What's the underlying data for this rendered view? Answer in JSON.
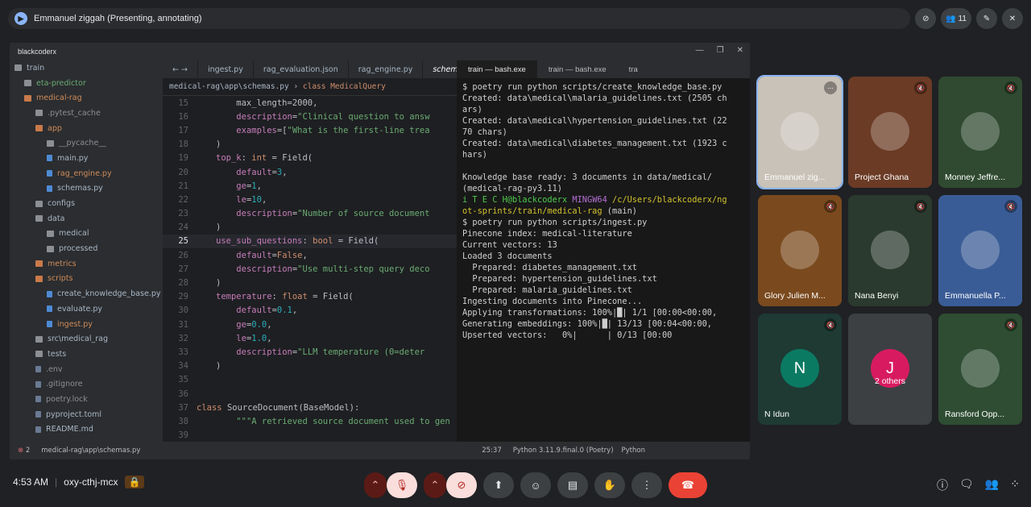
{
  "meeting": {
    "presenter": "Emmanuel ziggah (Presenting, annotating)",
    "time": "4:53 AM",
    "code": "oxy-cthj-mcx",
    "participant_count": "11"
  },
  "ide": {
    "window_title": "blackcoderx",
    "tree": [
      {
        "label": "train",
        "indent": 6,
        "type": "folder",
        "color": "#a9b7c6"
      },
      {
        "label": "eta-predictor",
        "indent": 18,
        "type": "folder",
        "color": "#6aab73"
      },
      {
        "label": "medical-rag",
        "indent": 18,
        "type": "folder-or",
        "color": "#d08c5a"
      },
      {
        "label": ".pytest_cache",
        "indent": 32,
        "type": "folder",
        "color": "#8c8f94"
      },
      {
        "label": "app",
        "indent": 32,
        "type": "folder-or",
        "color": "#d08c5a"
      },
      {
        "label": "__pycache__",
        "indent": 46,
        "type": "folder",
        "color": "#8c8f94"
      },
      {
        "label": "main.py",
        "indent": 46,
        "type": "file-py",
        "color": "#a9b7c6"
      },
      {
        "label": "rag_engine.py",
        "indent": 46,
        "type": "file-py",
        "color": "#d08c5a"
      },
      {
        "label": "schemas.py",
        "indent": 46,
        "type": "file-py",
        "color": "#a9b7c6"
      },
      {
        "label": "configs",
        "indent": 32,
        "type": "folder",
        "color": "#a9b7c6"
      },
      {
        "label": "data",
        "indent": 32,
        "type": "folder",
        "color": "#a9b7c6"
      },
      {
        "label": "medical",
        "indent": 46,
        "type": "folder",
        "color": "#a9b7c6"
      },
      {
        "label": "processed",
        "indent": 46,
        "type": "folder",
        "color": "#a9b7c6"
      },
      {
        "label": "metrics",
        "indent": 32,
        "type": "folder-or",
        "color": "#d08c5a"
      },
      {
        "label": "scripts",
        "indent": 32,
        "type": "folder-or",
        "color": "#d08c5a"
      },
      {
        "label": "create_knowledge_base.py",
        "indent": 46,
        "type": "file-py",
        "color": "#a9b7c6"
      },
      {
        "label": "evaluate.py",
        "indent": 46,
        "type": "file-py",
        "color": "#a9b7c6"
      },
      {
        "label": "ingest.py",
        "indent": 46,
        "type": "file-py",
        "color": "#d08c5a"
      },
      {
        "label": "src\\medical_rag",
        "indent": 32,
        "type": "folder",
        "color": "#a9b7c6"
      },
      {
        "label": "tests",
        "indent": 32,
        "type": "folder",
        "color": "#a9b7c6"
      },
      {
        "label": ".env",
        "indent": 32,
        "type": "file",
        "color": "#8c8f94"
      },
      {
        "label": ".gitignore",
        "indent": 32,
        "type": "file",
        "color": "#8c8f94"
      },
      {
        "label": "poetry.lock",
        "indent": 32,
        "type": "file",
        "color": "#8c8f94"
      },
      {
        "label": "pyproject.toml",
        "indent": 32,
        "type": "file",
        "color": "#a9b7c6"
      },
      {
        "label": "README.md",
        "indent": 32,
        "type": "file",
        "color": "#a9b7c6"
      }
    ],
    "editor_tabs": [
      "ingest.py",
      "rag_evaluation.json",
      "rag_engine.py",
      "schemas"
    ],
    "breadcrumb_path": "medical-rag\\app\\schemas.py",
    "breadcrumb_class": "class MedicalQuery",
    "code_lines": [
      {
        "n": "15",
        "html": "    max_length=2000,"
      },
      {
        "n": "16",
        "html": "    <span class='id'>description</span>=<span class='st'>\"Clinical question to answ</span>"
      },
      {
        "n": "17",
        "html": "    <span class='id'>examples</span>=[<span class='st'>\"What is the first-line trea</span>"
      },
      {
        "n": "18",
        "html": ")"
      },
      {
        "n": "19",
        "html": "<span class='id'>top_k</span>: <span class='kw'>int</span> = Field("
      },
      {
        "n": "20",
        "html": "    <span class='id'>default</span>=<span class='nm'>3</span>,"
      },
      {
        "n": "21",
        "html": "    <span class='id'>ge</span>=<span class='nm'>1</span>,"
      },
      {
        "n": "22",
        "html": "    <span class='id'>le</span>=<span class='nm'>10</span>,"
      },
      {
        "n": "23",
        "html": "    <span class='id'>description</span>=<span class='st'>\"Number of source document</span>"
      },
      {
        "n": "24",
        "html": ")"
      },
      {
        "n": "25",
        "html": "<span class='id'>use_sub_questions</span>: <span class='kw'>bool</span> = Field(",
        "cur": true
      },
      {
        "n": "26",
        "html": "    <span class='id'>default</span>=<span class='kw'>False</span>,"
      },
      {
        "n": "27",
        "html": "    <span class='id'>description</span>=<span class='st'>\"Use multi-step query deco</span>"
      },
      {
        "n": "28",
        "html": ")"
      },
      {
        "n": "29",
        "html": "<span class='id'>temperature</span>: <span class='kw'>float</span> = Field("
      },
      {
        "n": "30",
        "html": "    <span class='id'>default</span>=<span class='nm'>0.1</span>,"
      },
      {
        "n": "31",
        "html": "    <span class='id'>ge</span>=<span class='nm'>0.0</span>,"
      },
      {
        "n": "32",
        "html": "    <span class='id'>le</span>=<span class='nm'>1.0</span>,"
      },
      {
        "n": "33",
        "html": "    <span class='id'>description</span>=<span class='st'>\"LLM temperature (0=deter</span>"
      },
      {
        "n": "34",
        "html": ")"
      },
      {
        "n": "35",
        "html": ""
      },
      {
        "n": "36",
        "html": ""
      },
      {
        "n": "37",
        "html": "<span class='kw' style='margin-left:-24px'>class</span> <span class='cls'>SourceDocument(BaseModel):</span>"
      },
      {
        "n": "38",
        "html": "    <span class='st'>\"\"\"A retrieved source document used to gen</span>"
      },
      {
        "n": "39",
        "html": ""
      }
    ],
    "terminal_tabs": [
      "train — bash.exe",
      "train — bash.exe",
      "tra"
    ],
    "terminal_lines": [
      "$ poetry run python scripts/create_knowledge_base.py",
      "Created: data\\medical\\malaria_guidelines.txt (2505 ch",
      "ars)",
      "Created: data\\medical\\hypertension_guidelines.txt (22",
      "70 chars)",
      "Created: data\\medical\\diabetes_management.txt (1923 c",
      "hars)",
      "",
      "Knowledge base ready: 3 documents in data/medical/",
      "(medical-rag-py3.11)",
      "<span class='tg'>i T E C H@blackcoderx</span> <span class='tp'>MINGW64</span> <span class='ty'>/c/Users/blackcoderx/ng</span>",
      "<span class='ty'>ot-sprints/train/medical-rag</span> (main)",
      "$ poetry run python scripts/ingest.py",
      "Pinecone index: medical-literature",
      "Current vectors: 13",
      "Loaded 3 documents",
      "  Prepared: diabetes_management.txt",
      "  Prepared: hypertension_guidelines.txt",
      "  Prepared: malaria_guidelines.txt",
      "Ingesting documents into Pinecone...",
      "Applying transformations: 100%|█| 1/1 [00:00<00:00,",
      "Generating embeddings: 100%|█| 13/13 [00:04<00:00,",
      "Upserted vectors:   0%|      | 0/13 [00:00<?, ?it/s]"
    ],
    "status": {
      "errors": "2",
      "path": "medical-rag\\app\\schemas.py",
      "position": "25:37",
      "interpreter": "Python 3.11.9.final.0 (Poetry)",
      "language": "Python"
    }
  },
  "participants": [
    {
      "name": "Emmanuel zig...",
      "col": 0,
      "row": 0,
      "bg": "#c9c2b8",
      "avatar": "",
      "muted": false,
      "speaking": true
    },
    {
      "name": "Project Ghana",
      "col": 1,
      "row": 0,
      "bg": "#6b3b25",
      "avatar": "",
      "muted": true
    },
    {
      "name": "Monney Jeffre...",
      "col": 2,
      "row": 0,
      "bg": "#2f4a30",
      "avatar": "",
      "muted": true
    },
    {
      "name": "Glory Julien M...",
      "col": 0,
      "row": 1,
      "bg": "#7a4a1e",
      "avatar": "",
      "muted": true
    },
    {
      "name": "Nana Benyi",
      "col": 1,
      "row": 1,
      "bg": "#2a3a2e",
      "avatar": "",
      "muted": true
    },
    {
      "name": "Emmanuella P...",
      "col": 2,
      "row": 1,
      "bg": "#3a5c96",
      "avatar": "",
      "muted": true
    },
    {
      "name": "N Idun",
      "col": 0,
      "row": 2,
      "bg": "#1e3a33",
      "avatar": "N",
      "avatar_bg": "#0b7a63",
      "muted": true
    },
    {
      "name": "2 others",
      "col": 1,
      "row": 2,
      "bg": "#3c4043",
      "avatar": "J",
      "avatar_bg": "#d81b60",
      "muted": false,
      "others": true
    },
    {
      "name": "Ransford Opp...",
      "col": 2,
      "row": 2,
      "bg": "#2e4d33",
      "avatar": "",
      "muted": true
    }
  ]
}
